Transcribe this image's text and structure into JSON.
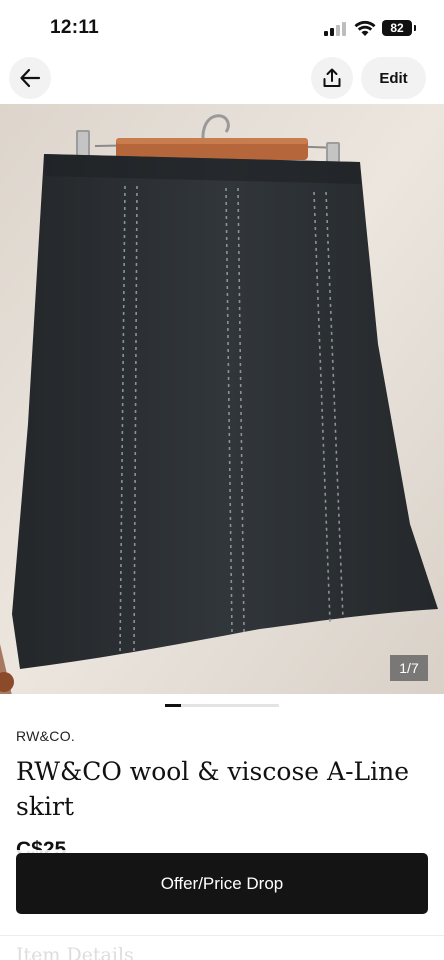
{
  "status_bar": {
    "time": "12:11",
    "battery": "82",
    "icons": [
      "signal-icon",
      "wifi-icon",
      "battery-icon"
    ]
  },
  "nav": {
    "back_icon": "arrow-left-icon",
    "share_icon": "share-upload-icon",
    "edit_label": "Edit"
  },
  "photo": {
    "counter": "1/7",
    "pager_position": 1,
    "pager_total": 7
  },
  "listing": {
    "brand": "RW&CO.",
    "title": "RW&CO wool & viscose A-Line skirt",
    "price": "C$25"
  },
  "actions": {
    "offer_label": "Offer/Price Drop"
  },
  "sections": {
    "item_details_heading": "Item Details"
  },
  "colors": {
    "button_dark": "#141414",
    "skirt": "#2a2e31",
    "wall": "#e6dfd8"
  }
}
